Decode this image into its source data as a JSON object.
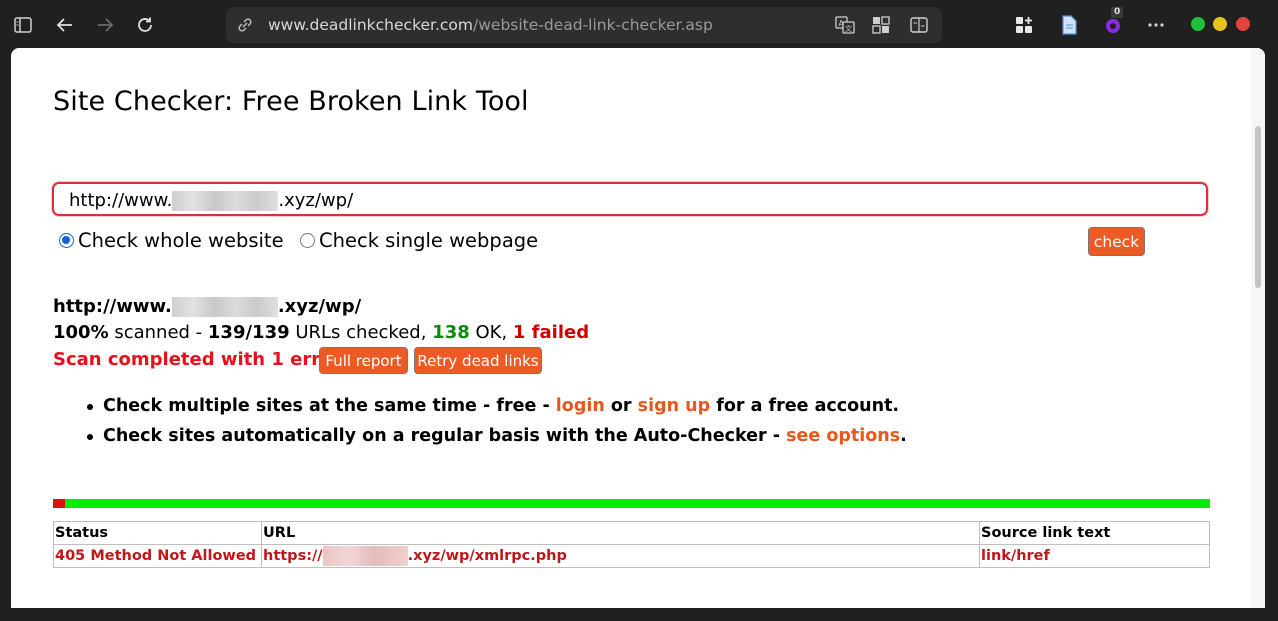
{
  "browser": {
    "url_host": "www.deadlinkchecker.com",
    "url_path": "/website-dead-link-checker.asp",
    "extension_badge": "0",
    "icons": [
      "sidebar-icon",
      "back-icon",
      "forward-icon",
      "refresh-icon",
      "site-info-icon",
      "read-aloud-icon",
      "apps-icon",
      "split-screen-icon",
      "collections-icon",
      "document-icon",
      "extension-icon",
      "more-icon"
    ],
    "window_controls": {
      "minimize": "#1fbf3a",
      "maximize": "#e6c21c",
      "close": "#e0443a"
    }
  },
  "page": {
    "title": "Site Checker: Free Broken Link Tool",
    "input": {
      "prefix": "http://www.",
      "suffix": ".xyz/wp/"
    },
    "options": [
      {
        "label": "Check whole website",
        "checked": true
      },
      {
        "label": "Check single webpage",
        "checked": false
      }
    ],
    "check_button": "check",
    "result": {
      "url_prefix": "http://www.",
      "url_suffix": ".xyz/wp/",
      "percent": "100%",
      "scanned_word": " scanned - ",
      "count": "139/139",
      "urls_checked": " URLs checked, ",
      "ok_count": "138",
      "ok_word": " OK, ",
      "failed": "1 failed",
      "completed_message": "Scan completed with 1 error.",
      "full_report_button": "Full report",
      "retry_button": "Retry dead links",
      "progress_failed_fraction": 0.0104
    },
    "bullets": [
      {
        "before": "Check multiple sites at the same time - free - ",
        "link1": "login",
        "middle": " or ",
        "link2": "sign up",
        "after": " for a free account."
      },
      {
        "before": "Check sites automatically on a regular basis with the Auto-Checker - ",
        "link": "see options",
        "after": "."
      }
    ],
    "table": {
      "headers": [
        "Status",
        "URL",
        "Source link text"
      ],
      "rows": [
        {
          "status": "405 Method Not Allowed",
          "url_prefix": "https://",
          "url_suffix": ".xyz/wp/xmlrpc.php",
          "source": "link/href"
        }
      ]
    },
    "accent_color": "#ee5a24"
  }
}
